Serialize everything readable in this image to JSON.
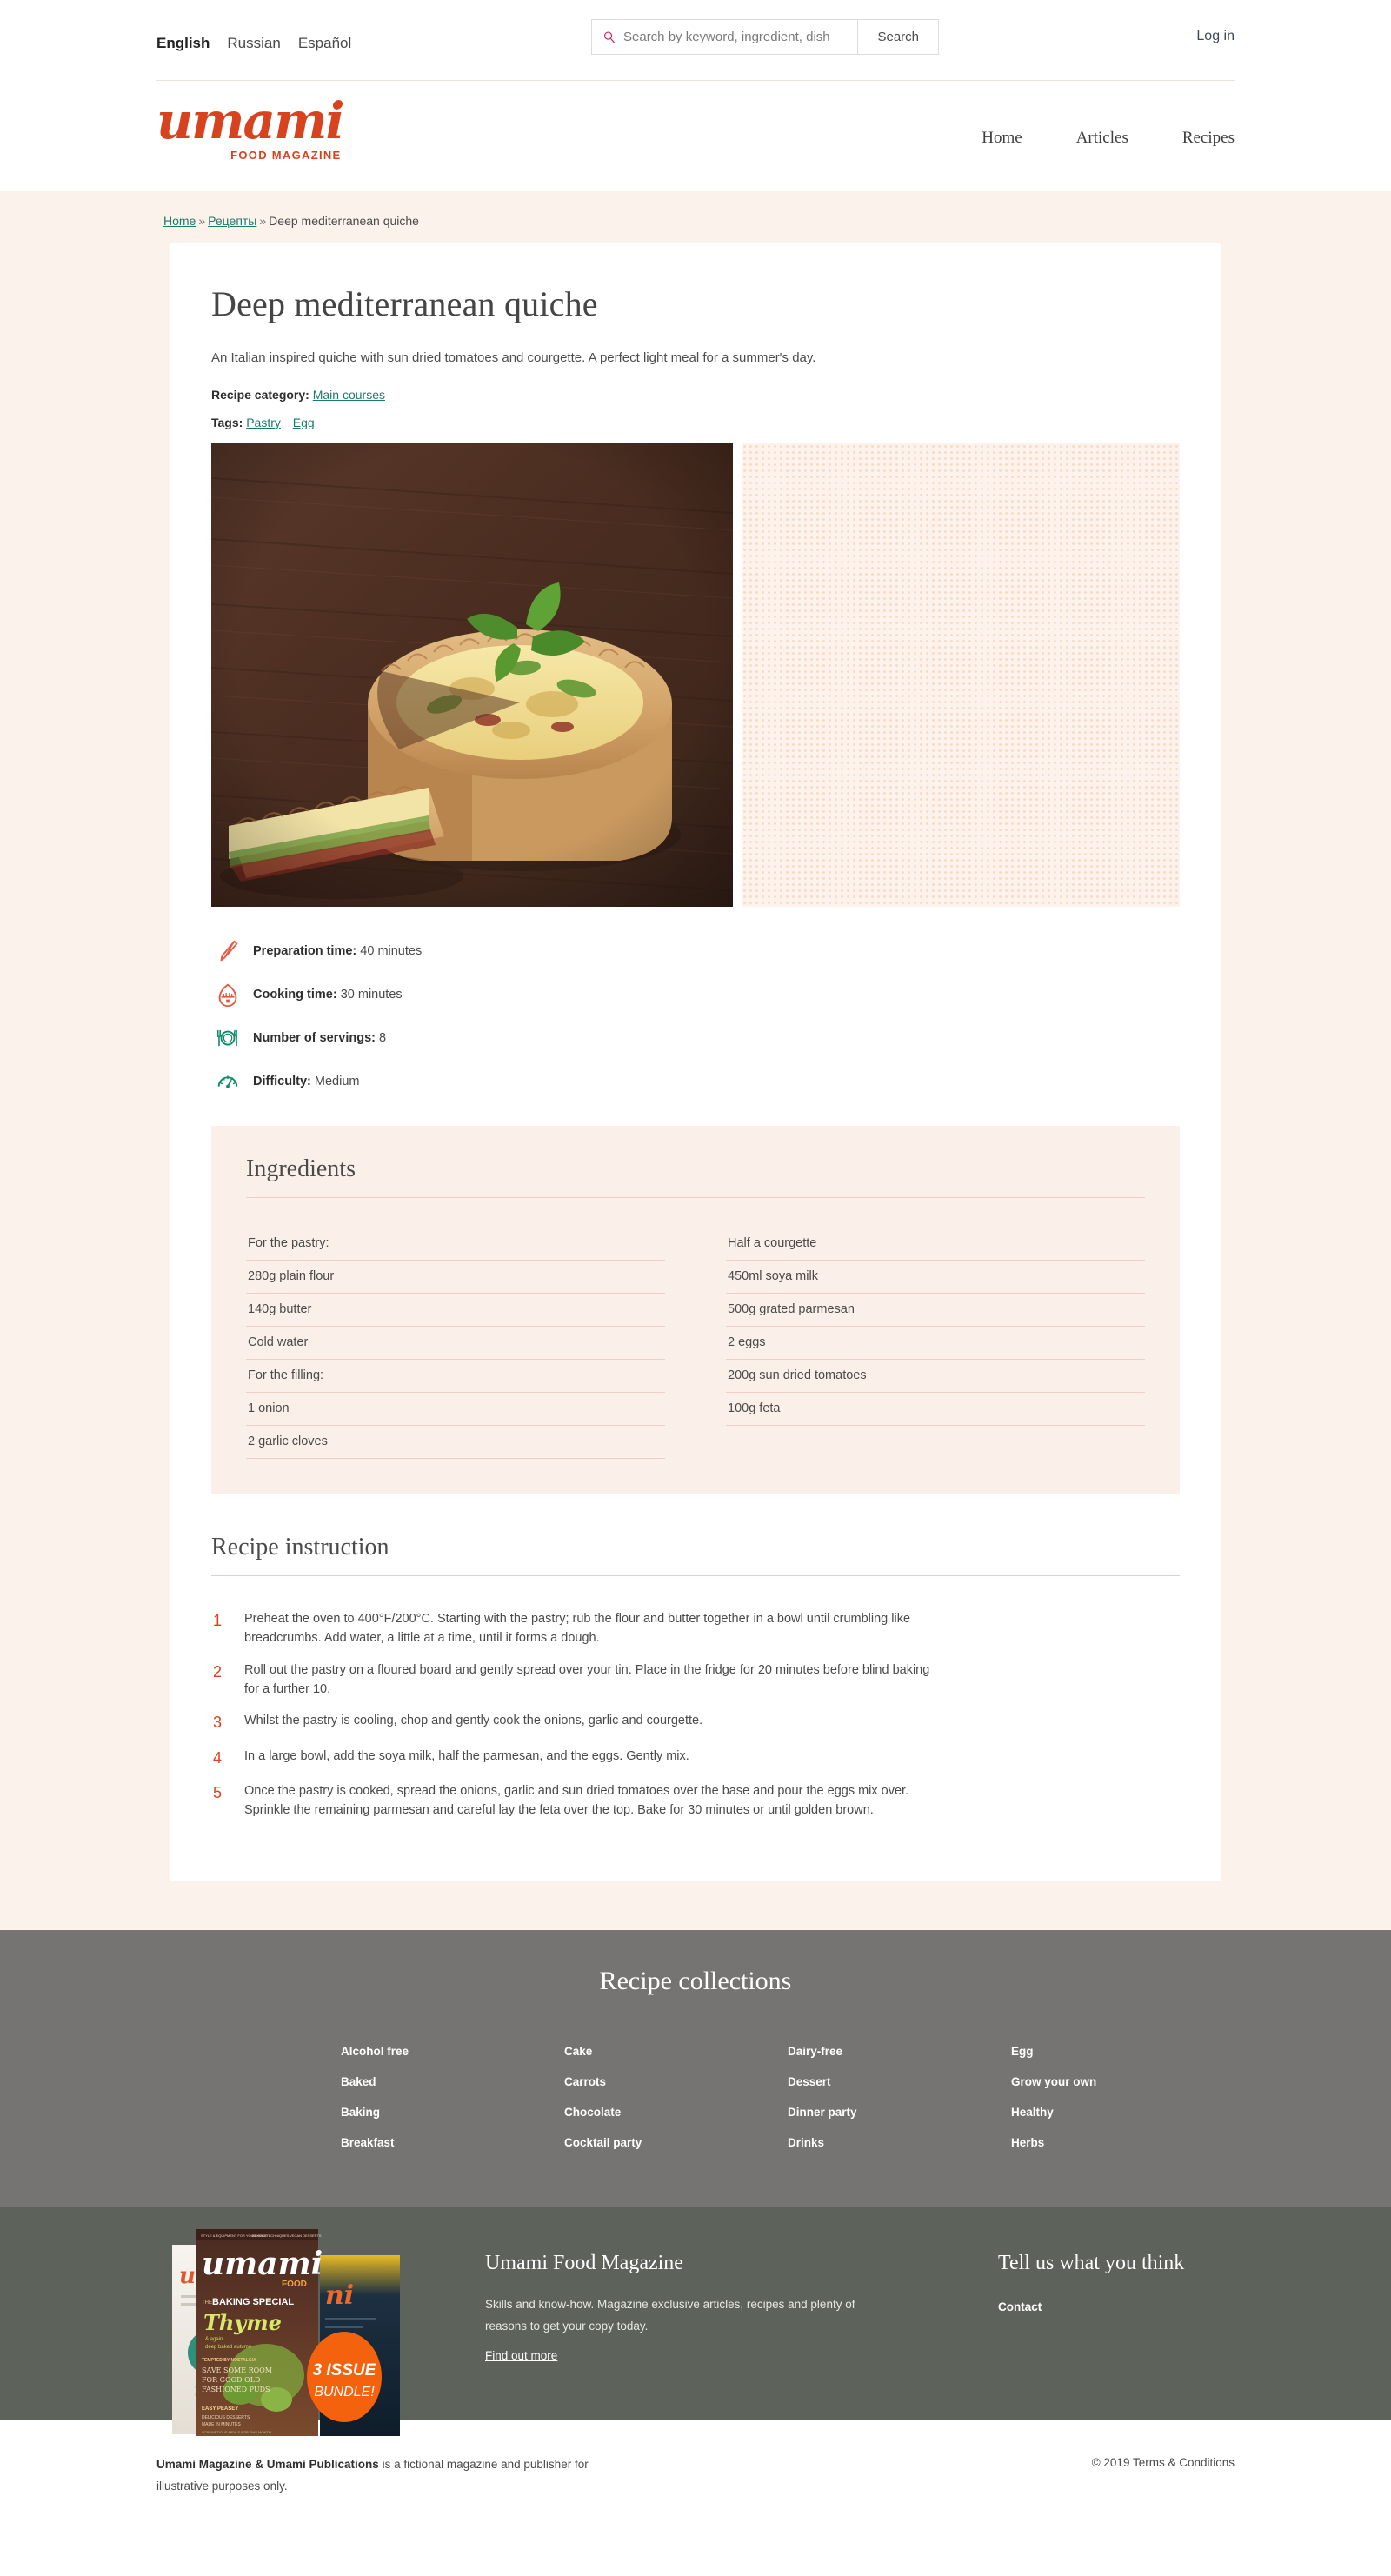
{
  "topbar": {
    "languages": [
      {
        "label": "English",
        "active": true
      },
      {
        "label": "Russian",
        "active": false
      },
      {
        "label": "Español",
        "active": false
      }
    ],
    "search": {
      "icon": "magnifier-icon",
      "placeholder": "Search by keyword, ingredient, dish",
      "value": "",
      "button_label": "Search"
    },
    "login_label": "Log in"
  },
  "brand": {
    "wordmark": "umami",
    "tagline": "FOOD MAGAZINE",
    "accent_color": "#d8431f"
  },
  "nav": [
    {
      "label": "Home"
    },
    {
      "label": "Articles"
    },
    {
      "label": "Recipes"
    }
  ],
  "breadcrumb": {
    "home": "Home",
    "section": "Рецепты",
    "current": "Deep mediterranean quiche",
    "separator": "»"
  },
  "recipe": {
    "title": "Deep mediterranean quiche",
    "description": "An Italian inspired quiche with sun dried tomatoes and courgette. A perfect light meal for a summer's day.",
    "category_label": "Recipe category:",
    "category_value": "Main courses",
    "tags_label": "Tags:",
    "tags": [
      "Pastry",
      "Egg"
    ],
    "hero_alt": "Deep mediterranean quiche on a wooden board",
    "facts": [
      {
        "icon": "knife-icon",
        "label": "Preparation time:",
        "value": "40 minutes",
        "color": "#e8573f"
      },
      {
        "icon": "egg-timer-icon",
        "label": "Cooking time:",
        "value": "30 minutes",
        "color": "#e8573f"
      },
      {
        "icon": "plate-cutlery-icon",
        "label": "Number of servings:",
        "value": "8",
        "color": "#0f8a6a"
      },
      {
        "icon": "gauge-icon",
        "label": "Difficulty:",
        "value": "Medium",
        "color": "#0f8a6a"
      }
    ],
    "ingredients": {
      "title": "Ingredients",
      "left_column": [
        "For the pastry:",
        "280g plain flour",
        "140g butter",
        "Cold water",
        "For the filling:",
        "1 onion",
        "2 garlic cloves"
      ],
      "right_column": [
        "Half a courgette",
        "450ml soya milk",
        "500g grated parmesan",
        "2 eggs",
        "200g sun dried tomatoes",
        "100g feta"
      ]
    },
    "instruction": {
      "title": "Recipe instruction",
      "steps": [
        {
          "number": "1",
          "text": "Preheat the oven to 400°F/200°C. Starting with the pastry; rub the flour and butter together in a bowl until crumbling like breadcrumbs. Add water, a little at a time, until it forms a dough."
        },
        {
          "number": "2",
          "text": "Roll out the pastry on a floured board and gently spread over your tin. Place in the fridge for 20 minutes before blind baking for a further 10."
        },
        {
          "number": "3",
          "text": "Whilst the pastry is cooling, chop and gently cook the onions, garlic and courgette."
        },
        {
          "number": "4",
          "text": "In a large bowl, add the soya milk, half the parmesan, and the eggs. Gently mix."
        },
        {
          "number": "5",
          "text": "Once the pastry is cooked, spread the onions, garlic and sun dried tomatoes over the base and pour the eggs mix over. Sprinkle the remaining parmesan and careful lay the feta over the top. Bake for 30 minutes or until golden brown."
        }
      ]
    }
  },
  "collections": {
    "title": "Recipe collections",
    "items": [
      "Alcohol free",
      "Cake",
      "Dairy-free",
      "Egg",
      "Baked",
      "Carrots",
      "Dessert",
      "Grow your own",
      "Baking",
      "Chocolate",
      "Dinner party",
      "Healthy",
      "Breakfast",
      "Cocktail party",
      "Drinks",
      "Herbs"
    ]
  },
  "promo": {
    "heading": "Umami Food Magazine",
    "body": "Skills and know-how. Magazine exclusive articles, recipes and plenty of reasons to get your copy today.",
    "link_label": "Find out more",
    "right_heading": "Tell us what you think",
    "contact_label": "Contact",
    "cover_badge_line1": "3 ISSUE",
    "cover_badge_line2": "BUNDLE!",
    "cover_wordmark": "umami",
    "cover_food": "FOOD",
    "cover_special": "BAKING SPECIAL",
    "cover_thyme": "Thyme"
  },
  "colophon": {
    "bold": "Umami Magazine & Umami Publications",
    "rest": " is a fictional magazine and publisher for illustrative purposes only.",
    "copyright": "© 2019 Terms & Conditions"
  }
}
